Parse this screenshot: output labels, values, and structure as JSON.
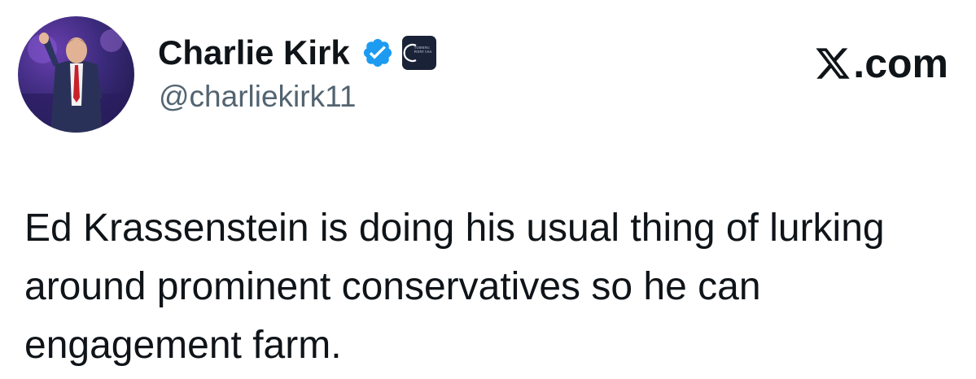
{
  "author": {
    "display_name": "Charlie Kirk",
    "handle": "@charliekirk11",
    "verified_icon": "verified-badge-icon",
    "affiliate_badge": {
      "icon": "turning-point-usa-logo",
      "text": "TURNING\nPOINT USA"
    }
  },
  "brand": {
    "icon": "x-logo-icon",
    "text": "X.com"
  },
  "tweet": {
    "lines": [
      "Ed Krassenstein is doing his usual thing of lurking",
      "around prominent conservatives so he can",
      "engagement farm."
    ]
  },
  "colors": {
    "text_primary": "#0f1419",
    "text_secondary": "#536471",
    "verified_blue": "#1d9bf0",
    "affiliate_bg": "#1a2238"
  }
}
